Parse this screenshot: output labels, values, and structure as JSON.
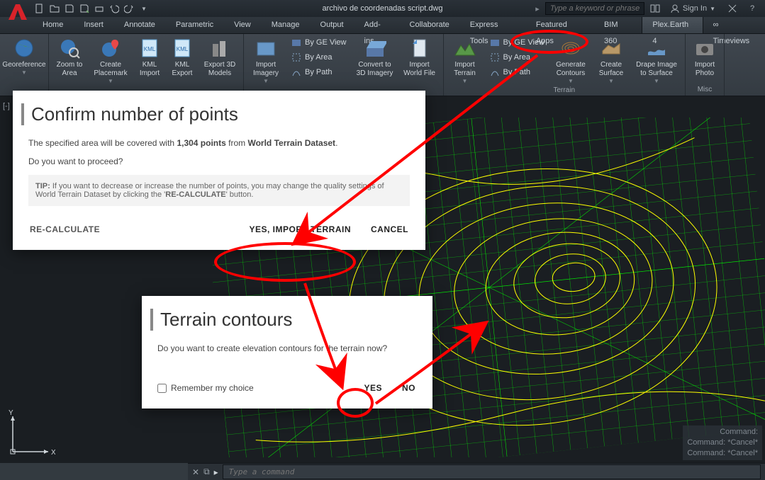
{
  "titlebar": {
    "filename": "archivo de coordenadas script.dwg",
    "search_placeholder": "Type a keyword or phrase",
    "signin": "Sign In"
  },
  "tabs": [
    "Home",
    "Insert",
    "Annotate",
    "Parametric",
    "View",
    "Manage",
    "Output",
    "Add-ins",
    "Collaborate",
    "Express Tools",
    "Featured Apps",
    "BIM 360",
    "Plex.Earth 4",
    "∞ Timeviews"
  ],
  "active_tab": 12,
  "ribbon": {
    "georeference": "Georeference",
    "zoom_area": "Zoom to Area",
    "create_placemark": "Create Placemark",
    "kml_import": "KML Import",
    "kml_export": "KML Export",
    "export_3d": "Export 3D Models",
    "import_imagery": "Import Imagery",
    "by_ge_view": "By GE View",
    "by_area": "By Area",
    "by_path": "By Path",
    "convert_3d": "Convert to 3D Imagery",
    "import_world": "Import World File",
    "import_terrain": "Import Terrain",
    "generate_contours": "Generate Contours",
    "create_surface": "Create Surface",
    "drape_image": "Drape Image to Surface",
    "import_photo": "Import Photo",
    "panel_terrain": "Terrain",
    "panel_misc": "Misc"
  },
  "dialog1": {
    "title": "Confirm number of points",
    "body_prefix": "The specified area will be covered with ",
    "points": "1,304 points",
    "body_mid": " from ",
    "dataset": "World Terrain Dataset",
    "body_suffix": ".",
    "proceed": "Do you want to proceed?",
    "tip_label": "TIP:",
    "tip_body": " If you want to decrease or increase the number of points, you may change the quality settings of World Terrain Dataset by clicking the '",
    "tip_recalc": "RE-CALCULATE",
    "tip_end": "' button.",
    "btn_recalc": "RE-CALCULATE",
    "btn_yes": "YES, IMPORT TERRAIN",
    "btn_cancel": "CANCEL"
  },
  "dialog2": {
    "title": "Terrain contours",
    "body": "Do you want to create elevation contours for the terrain now?",
    "remember": "Remember my choice",
    "yes": "YES",
    "no": "NO"
  },
  "cmd": {
    "history": [
      "Command:",
      "Command: *Cancel*",
      "Command: *Cancel*"
    ],
    "placeholder": "Type a command",
    "arrow": "▸"
  },
  "viewcube": {
    "label": "[-]"
  }
}
